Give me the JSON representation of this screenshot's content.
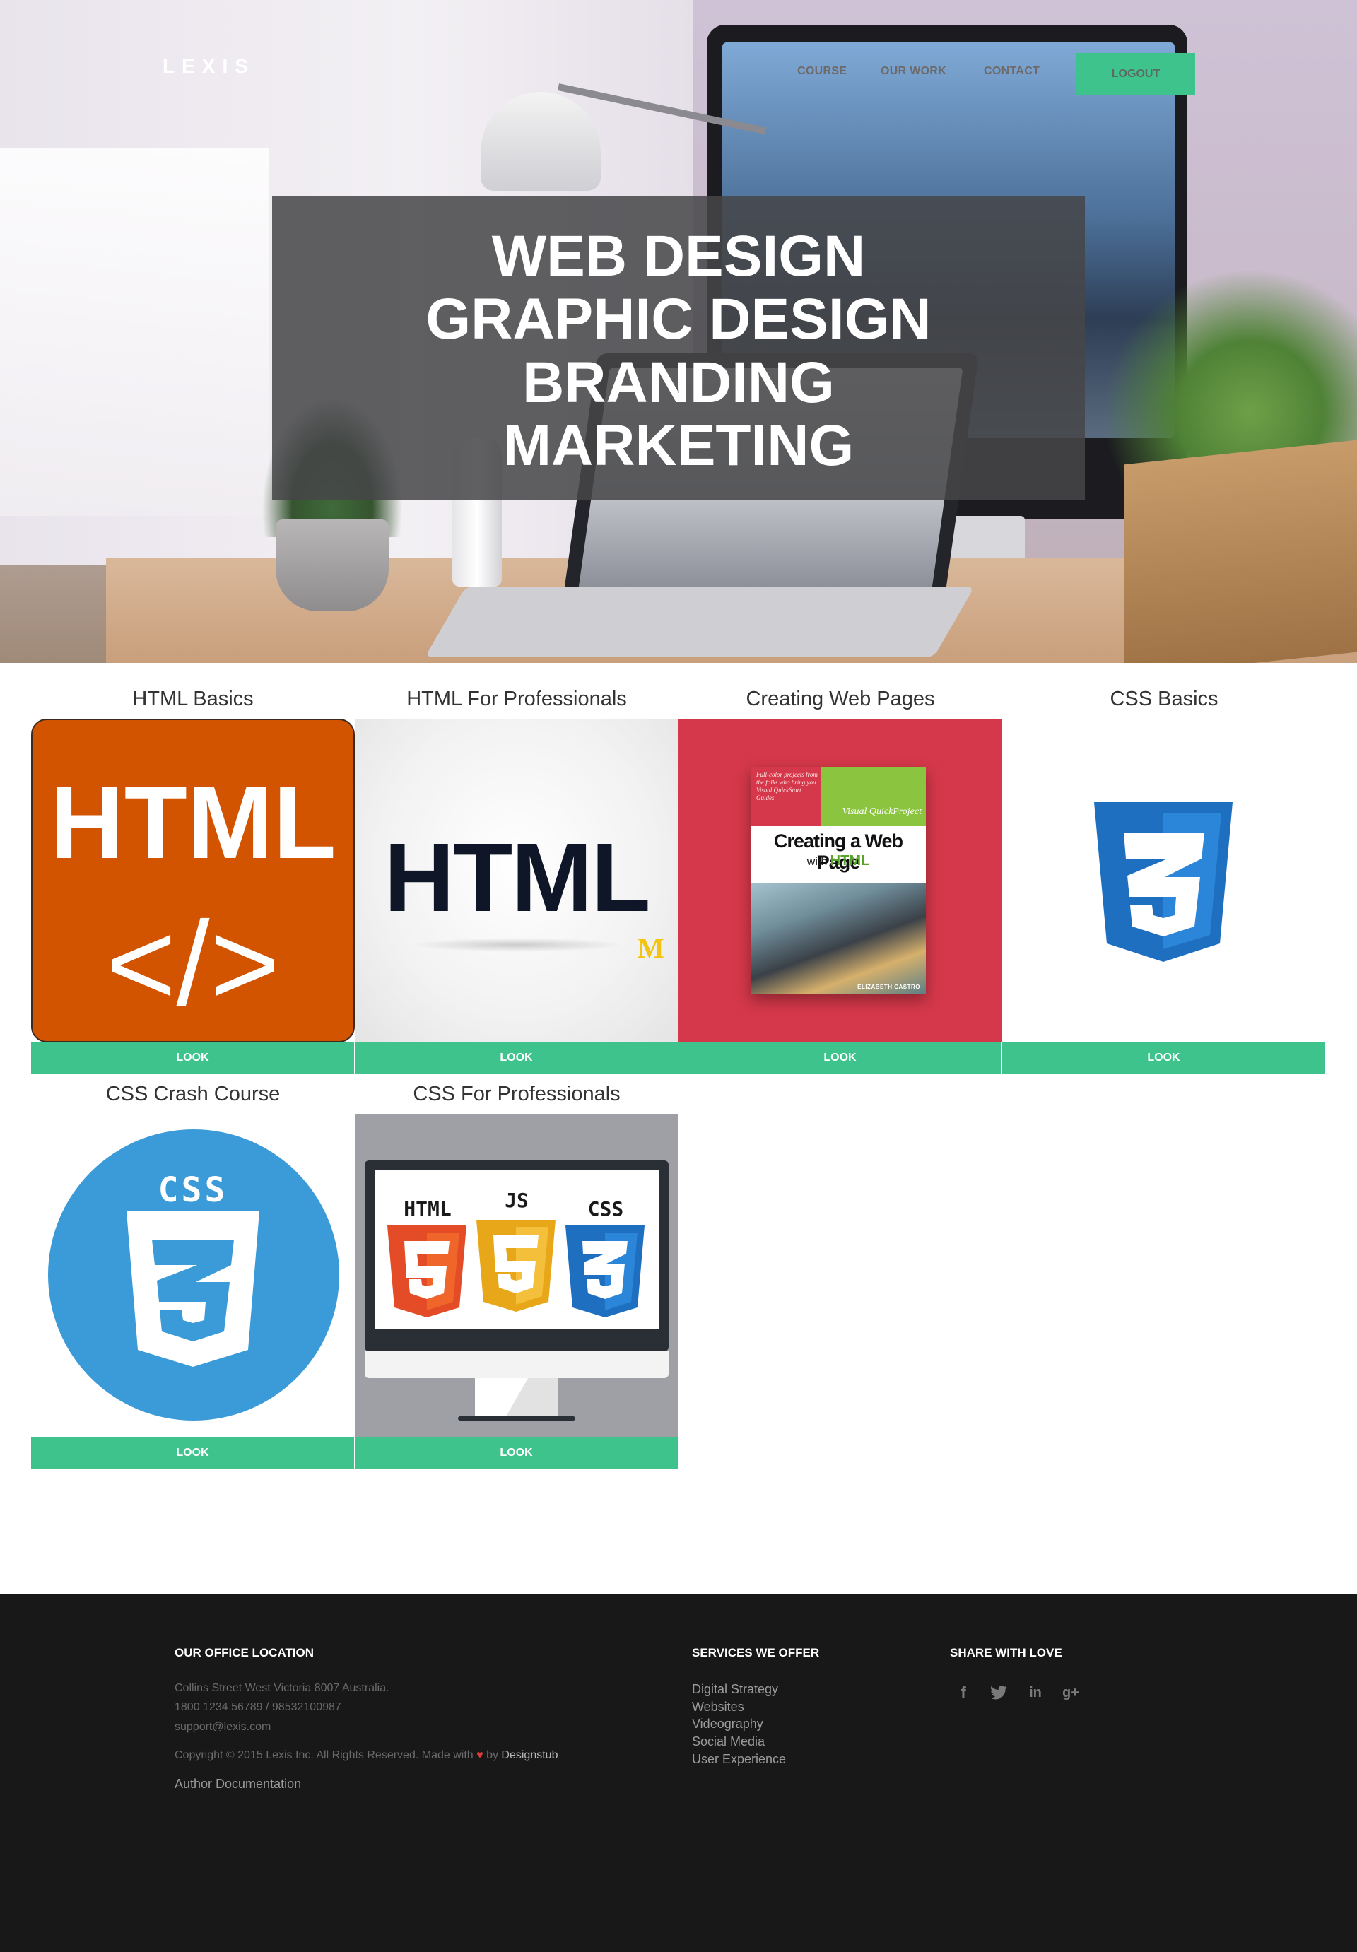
{
  "header": {
    "logo": "LEXIS",
    "nav": [
      {
        "label": "COURSE"
      },
      {
        "label": "OUR WORK"
      },
      {
        "label": "CONTACT"
      }
    ],
    "logout_label": "LOGOUT"
  },
  "hero": {
    "lines": [
      "WEB DESIGN",
      "GRAPHIC DESIGN",
      "BRANDING",
      "MARKETING"
    ]
  },
  "courses": [
    {
      "title": "HTML Basics",
      "button": "LOOK",
      "image_text": [
        "HTML",
        "</>"
      ]
    },
    {
      "title": "HTML For Professionals",
      "button": "LOOK",
      "image_text": [
        "HTML",
        "M"
      ]
    },
    {
      "title": "Creating Web Pages",
      "button": "LOOK",
      "image_text": [
        "Full-color projects from the folks who bring you Visual QuickStart Guides",
        "Visual QuickProject",
        "Creating a Web Page",
        "with",
        "HTML",
        "ELIZABETH CASTRO"
      ]
    },
    {
      "title": "CSS Basics",
      "button": "LOOK",
      "image_text": []
    },
    {
      "title": "CSS Crash Course",
      "button": "LOOK",
      "image_text": [
        "CSS"
      ]
    },
    {
      "title": "CSS For Professionals",
      "button": "LOOK",
      "image_text": [
        "HTML",
        "JS",
        "CSS"
      ]
    }
  ],
  "footer": {
    "office": {
      "heading": "OUR OFFICE LOCATION",
      "address": "Collins Street West Victoria 8007 Australia.",
      "phone": "1800 1234 56789 / 98532100987",
      "email": "support@lexis.com",
      "copyright_prefix": "Copyright © 2015 Lexis Inc. All Rights Reserved. Made with",
      "copyright_by": "by",
      "brand": "Designstub",
      "author_link": "Author Documentation"
    },
    "services": {
      "heading": "SERVICES WE OFFER",
      "items": [
        "Digital Strategy",
        "Websites",
        "Videography",
        "Social Media",
        "User Experience"
      ]
    },
    "share": {
      "heading": "SHARE WITH LOVE",
      "icons": [
        "facebook-icon",
        "twitter-icon",
        "linkedin-icon",
        "google-plus-icon"
      ]
    }
  },
  "colors": {
    "accent": "#3ec38d",
    "footer_bg": "#181818",
    "html_orange": "#d35400",
    "book_red": "#d5384a",
    "css_blue": "#1e6fc0"
  }
}
